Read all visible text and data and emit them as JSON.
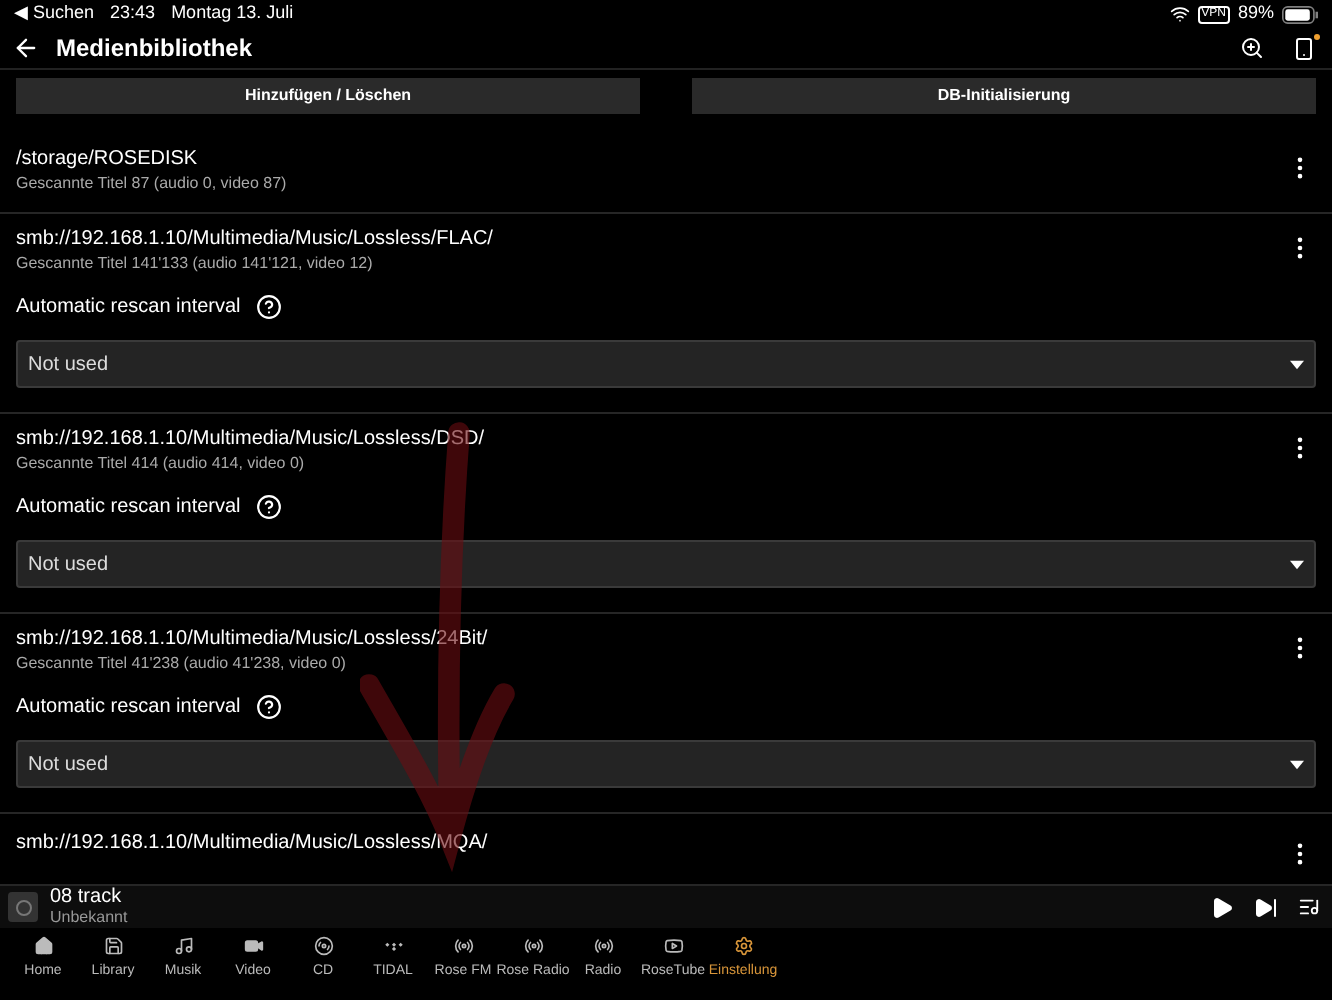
{
  "status_bar": {
    "back_app": "◀ Suchen",
    "time": "23:43",
    "date": "Montag 13. Juli",
    "vpn": "VPN",
    "battery": "89%"
  },
  "header": {
    "title": "Medienbibliothek",
    "notification_dot": true
  },
  "actions": [
    "Hinzufügen / Löschen",
    "DB-Initialisierung"
  ],
  "libraries": [
    {
      "kind": "plain",
      "path": "/storage/ROSEDISK",
      "subtitle": "Gescannte Titel 87 (audio 0, video 87)"
    },
    {
      "kind": "rescan",
      "path": "smb://192.168.1.10/Multimedia/Music/Lossless/FLAC/",
      "subtitle": "Gescannte Titel 141'133 (audio 141'121, video 12)",
      "rescan_label": "Automatic rescan interval",
      "rescan_value": "Not used"
    },
    {
      "kind": "rescan",
      "path": "smb://192.168.1.10/Multimedia/Music/Lossless/DSD/",
      "subtitle": "Gescannte Titel 414 (audio 414, video 0)",
      "rescan_label": "Automatic rescan interval",
      "rescan_value": "Not used"
    },
    {
      "kind": "rescan",
      "path": "smb://192.168.1.10/Multimedia/Music/Lossless/24Bit/",
      "subtitle": "Gescannte Titel 41'238 (audio 41'238, video 0)",
      "rescan_label": "Automatic rescan interval",
      "rescan_value": "Not used"
    },
    {
      "kind": "path_only",
      "path": "smb://192.168.1.10/Multimedia/Music/Lossless/MQA/"
    }
  ],
  "player": {
    "title": "08 track",
    "artist": "Unbekannt"
  },
  "nav": [
    {
      "kind": "home",
      "label": "Home",
      "selected": false
    },
    {
      "kind": "library",
      "label": "Library",
      "selected": false
    },
    {
      "kind": "music",
      "label": "Musik",
      "selected": false
    },
    {
      "kind": "video",
      "label": "Video",
      "selected": false
    },
    {
      "kind": "cd",
      "label": "CD",
      "selected": false
    },
    {
      "kind": "tidal",
      "label": "TIDAL",
      "selected": false
    },
    {
      "kind": "radio",
      "label": "Rose FM",
      "selected": false
    },
    {
      "kind": "radio",
      "label": "Rose Radio",
      "selected": false
    },
    {
      "kind": "radio",
      "label": "Radio",
      "selected": false
    },
    {
      "kind": "tube",
      "label": "RoseTube",
      "selected": false
    },
    {
      "kind": "settings",
      "label": "Einstellung",
      "selected": true
    }
  ]
}
